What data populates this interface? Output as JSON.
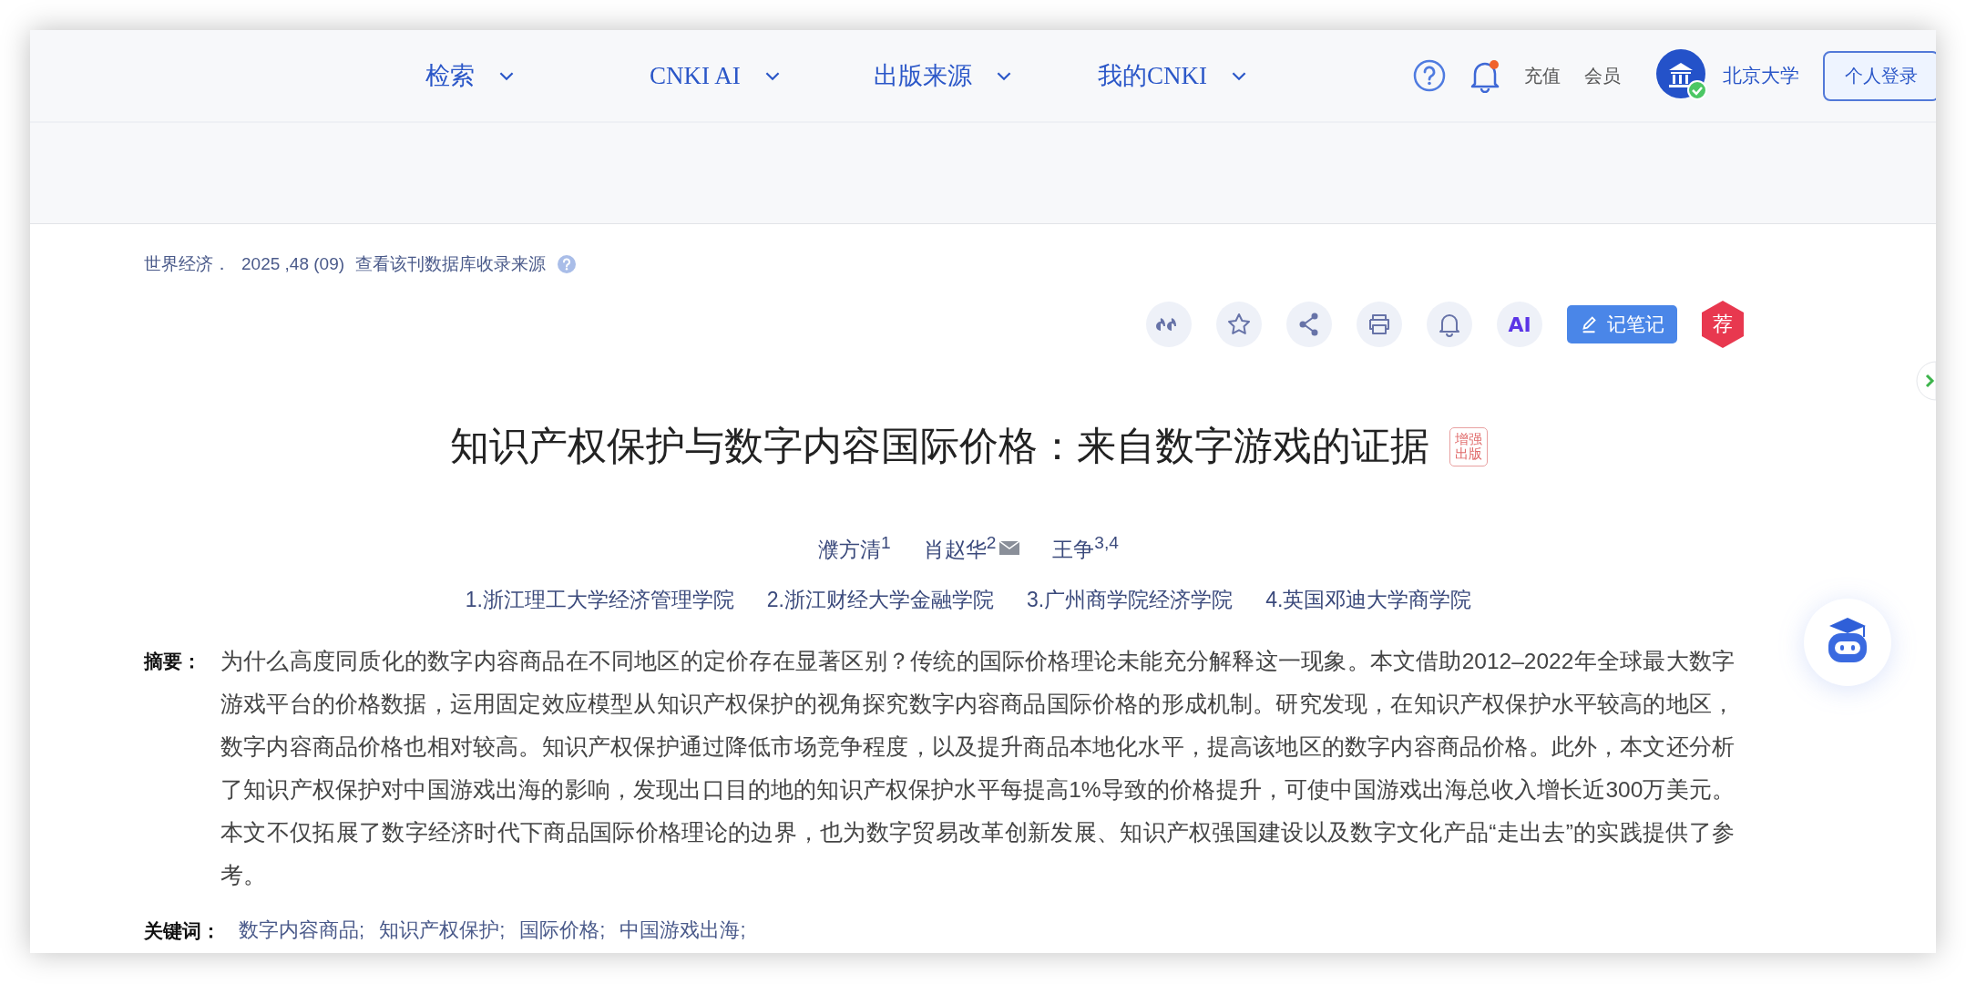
{
  "nav": {
    "items": [
      {
        "label": "检索"
      },
      {
        "label": "CNKI AI"
      },
      {
        "label": "出版来源"
      },
      {
        "label": "我的CNKI"
      }
    ],
    "links": [
      "充值",
      "会员"
    ],
    "institution": "北京大学",
    "login_button": "个人登录"
  },
  "source": {
    "journal": "世界经济．",
    "issue": "2025 ,48 (09)",
    "database_link": "查看该刊数据库收录来源"
  },
  "toolbar": {
    "ai_label": "AI",
    "note_button": "记笔记",
    "recommend_badge": "荐"
  },
  "title": "知识产权保护与数字内容国际价格：来自数字游戏的证据",
  "title_badge": "增强出版",
  "authors": [
    {
      "name": "濮方清$^{1}$",
      "email": false
    },
    {
      "name": "肖赵华$^{2}$",
      "email": true
    },
    {
      "name": "王争$^{3,4}$",
      "email": false
    }
  ],
  "affiliations": [
    "1.浙江理工大学经济管理学院",
    "2.浙江财经大学金融学院",
    "3.广州商学院经济学院",
    "4.英国邓迪大学商学院"
  ],
  "abstract": {
    "label": "摘要：",
    "text": "为什么高度同质化的数字内容商品在不同地区的定价存在显著区别？传统的国际价格理论未能充分解释这一现象。本文借助2012–2022年全球最大数字游戏平台的价格数据，运用固定效应模型从知识产权保护的视角探究数字内容商品国际价格的形成机制。研究发现，在知识产权保护水平较高的地区，数字内容商品价格也相对较高。知识产权保护通过降低市场竞争程度，以及提升商品本地化水平，提高该地区的数字内容商品价格。此外，本文还分析了知识产权保护对中国游戏出海的影响，发现出口目的地的知识产权保护水平每提高1%导致的价格提升，可使中国游戏出海总收入增长近300万美元。本文不仅拓展了数字经济时代下商品国际价格理论的边界，也为数字贸易改革创新发展、知识产权强国建设以及数字文化产品“走出去”的实践提供了参考。"
  },
  "keywords": {
    "label": "关键词：",
    "items": [
      "数字内容商品;",
      "知识产权保护;",
      "国际价格;",
      "中国游戏出海;"
    ]
  }
}
